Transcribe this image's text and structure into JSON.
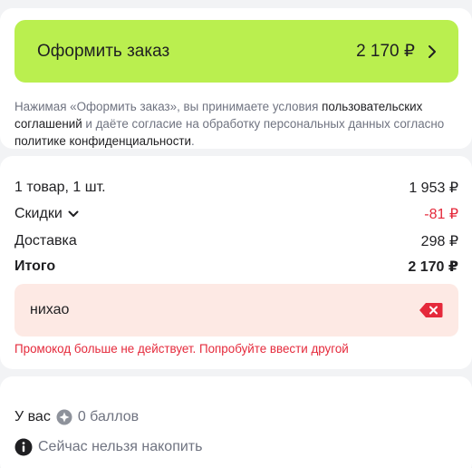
{
  "checkout": {
    "button_label": "Оформить заказ",
    "button_price": "2 170 ₽",
    "terms_prefix": "Нажимая «Оформить заказ», вы принимаете условия ",
    "terms_link_agreements": "пользовательских соглашений",
    "terms_middle": " и даёте согласие на обработку персональных данных согласно ",
    "terms_link_privacy": "политике конфиденциальности",
    "terms_suffix": "."
  },
  "summary": {
    "items_label": "1 товар, 1 шт.",
    "items_value": "1 953 ₽",
    "discounts_label": "Скидки",
    "discounts_value": "-81 ₽",
    "delivery_label": "Доставка",
    "delivery_value": "298 ₽",
    "total_label": "Итого",
    "total_value": "2 170 ₽"
  },
  "promo": {
    "value": "нихао",
    "error": "Промокод больше не действует. Попробуйте ввести другой"
  },
  "bonus": {
    "prefix": "У вас",
    "points": "0 баллов",
    "accrual_info": "Сейчас нельзя накопить"
  },
  "colors": {
    "accent_green": "#baef4f",
    "error_red": "#e5293b",
    "promo_bg": "#fde9e4"
  }
}
